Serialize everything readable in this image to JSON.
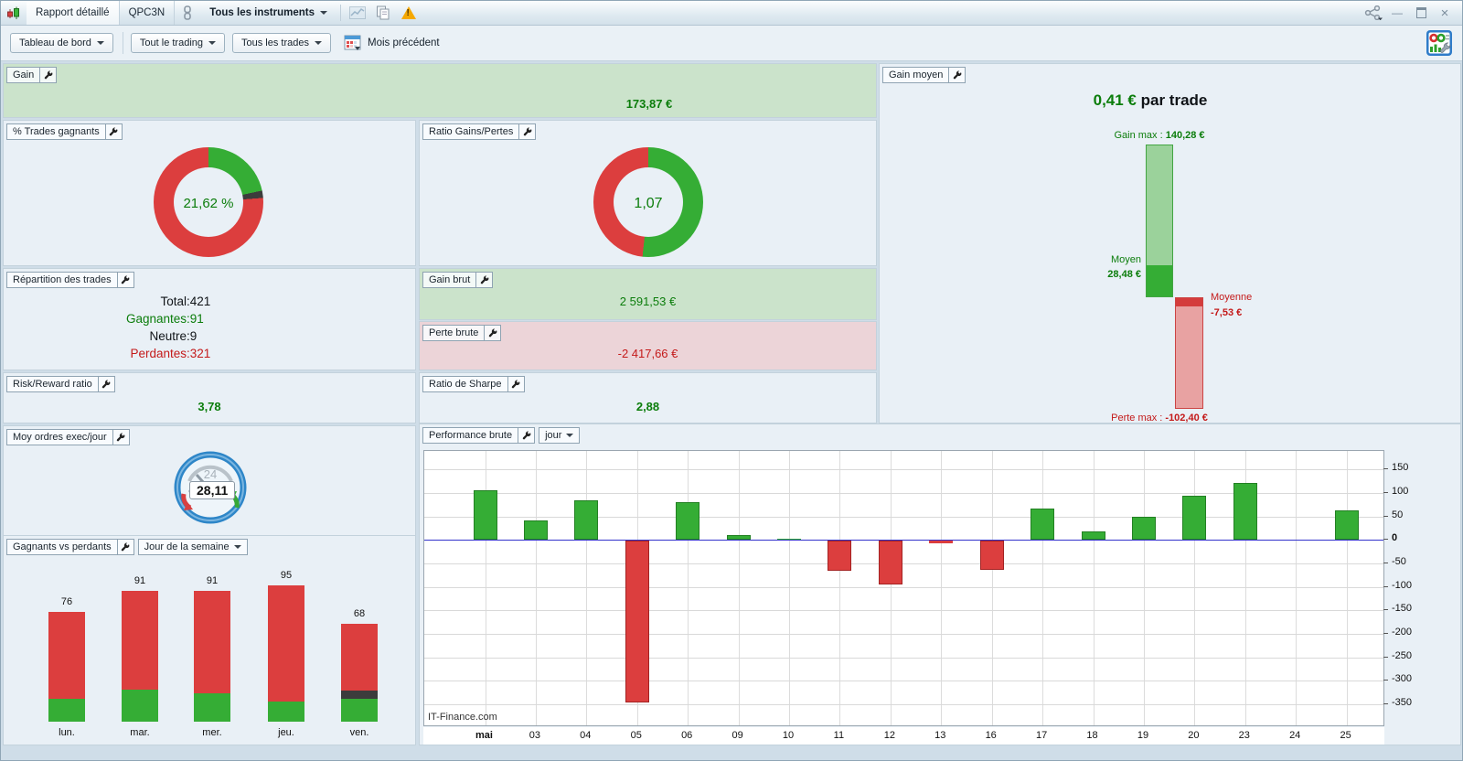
{
  "window": {
    "tabs": [
      "Rapport détaillé",
      "QPC3N"
    ],
    "instrument_selector": "Tous les instruments",
    "icons": [
      "candlestick-icon",
      "link-icon",
      "chart-icon",
      "copy-icon",
      "warning-icon",
      "share-icon",
      "minimize-icon",
      "restore-icon",
      "close-icon"
    ]
  },
  "toolbar": {
    "dashboard_button": "Tableau de bord",
    "trading_scope_button": "Tout le trading",
    "trades_scope_button": "Tous les trades",
    "period_label": "Mois précédent"
  },
  "panels": {
    "gain": {
      "label": "Gain",
      "value": "173,87 €"
    },
    "pct_winning": {
      "label": "% Trades gagnants",
      "value": "21,62 %"
    },
    "ratio_gains_pertes": {
      "label": "Ratio Gains/Pertes",
      "value": "1,07"
    },
    "repartition": {
      "label": "Répartition des trades",
      "rows": [
        {
          "label": "Total",
          "value": "421",
          "color": "tdark"
        },
        {
          "label": "Gagnantes",
          "value": "91",
          "color": "tgreen"
        },
        {
          "label": "Neutre",
          "value": "9",
          "color": "tdark"
        },
        {
          "label": "Perdantes",
          "value": "321",
          "color": "tred"
        }
      ],
      "separator": " : "
    },
    "gain_brut": {
      "label": "Gain brut",
      "value": "2 591,53 €"
    },
    "perte_brute": {
      "label": "Perte brute",
      "value": "-2 417,66 €"
    },
    "risk_reward": {
      "label": "Risk/Reward ratio",
      "value": "3,78"
    },
    "ratio_sharpe": {
      "label": "Ratio de Sharpe",
      "value": "2,88"
    },
    "gain_moyen": {
      "label": "Gain moyen",
      "headline_value": "0,41 €",
      "headline_suffix": " par trade",
      "gain_max_label": "Gain max : ",
      "gain_max_value": "140,28 €",
      "moyen_label": "Moyen",
      "moyen_value": "28,48 €",
      "moyenne_label": "Moyenne",
      "moyenne_value": "-7,53 €",
      "perte_max_label": "Perte max : ",
      "perte_max_value": "-102,40 €"
    },
    "moy_ordres": {
      "label": "Moy ordres exec/jour",
      "value": "28,11",
      "gauge_dial_text": "24"
    },
    "gagnants_perdants": {
      "label": "Gagnants vs perdants",
      "dropdown": "Jour de la semaine"
    },
    "performance": {
      "label": "Performance brute",
      "dropdown": "jour",
      "watermark": "IT-Finance.com"
    }
  },
  "colors": {
    "green_fill": "#35ad35",
    "green_border": "#238023",
    "green_light": "#9bd29b",
    "red_fill": "#dc3e3e",
    "red_border": "#a32222",
    "red_light": "#e8a2a2",
    "neutral_slice": "#3c3c3c",
    "text_green": "#0b7d0b",
    "text_red": "#c41a1a",
    "zero_line_blue": "#3333cc",
    "gain_panel_bg": "#cbe3cb",
    "loss_panel_bg": "#ecd4d8"
  },
  "chart_data": [
    {
      "id": "pct_trades_gagnants",
      "type": "pie",
      "subtype": "donut",
      "title": "% Trades gagnants",
      "center_label": "21,62 %",
      "slices": [
        {
          "label": "gagnants",
          "pct": 21.62,
          "color": "#35ad35"
        },
        {
          "label": "neutres",
          "pct": 2.14,
          "color": "#3c3c3c"
        },
        {
          "label": "perdants",
          "pct": 76.24,
          "color": "#dc3e3e"
        }
      ]
    },
    {
      "id": "ratio_gains_pertes",
      "type": "pie",
      "subtype": "donut",
      "title": "Ratio Gains/Pertes",
      "center_label": "1,07",
      "slices": [
        {
          "label": "gains",
          "pct": 51.7,
          "color": "#35ad35"
        },
        {
          "label": "pertes",
          "pct": 48.3,
          "color": "#dc3e3e"
        }
      ]
    },
    {
      "id": "gain_moyen",
      "type": "bar",
      "title": "Gain moyen (€)",
      "average_per_trade": 0.41,
      "bars": [
        {
          "label": "Gain max",
          "value": 140.28
        },
        {
          "label": "Moyen",
          "value": 28.48
        },
        {
          "label": "Moyenne",
          "value": -7.53
        },
        {
          "label": "Perte max",
          "value": -102.4
        }
      ]
    },
    {
      "id": "gagnants_vs_perdants",
      "type": "bar",
      "subtype": "stacked",
      "title": "Gagnants vs perdants — Jour de la semaine",
      "categories": [
        "lun.",
        "mar.",
        "mer.",
        "jeu.",
        "ven."
      ],
      "totals": [
        76,
        91,
        91,
        95,
        68
      ],
      "series": [
        {
          "name": "gagnants",
          "color": "#35ad35",
          "values": [
            16,
            22,
            20,
            14,
            16
          ]
        },
        {
          "name": "neutres",
          "color": "#3c3c3c",
          "values": [
            0,
            0,
            0,
            0,
            6
          ]
        },
        {
          "name": "perdants",
          "color": "#dc3e3e",
          "values": [
            60,
            69,
            71,
            81,
            46
          ]
        }
      ],
      "note": "segment splits estimated from pixel proportions; totals are labeled on chart"
    },
    {
      "id": "performance_brute",
      "type": "bar",
      "title": "Performance brute — jour",
      "categories": [
        "mai",
        "03",
        "04",
        "05",
        "06",
        "09",
        "10",
        "11",
        "12",
        "13",
        "16",
        "17",
        "18",
        "19",
        "20",
        "23",
        "24",
        "25"
      ],
      "values": [
        106,
        41,
        84,
        -344,
        80,
        10,
        1,
        -65,
        -93,
        -5,
        -62,
        67,
        17,
        48,
        93,
        120,
        0,
        63
      ],
      "yticks": [
        150,
        100,
        50,
        0,
        -50,
        -100,
        -150,
        -200,
        -250,
        -300,
        -350
      ],
      "ylim": [
        -390,
        185
      ],
      "grid": true,
      "y_axis_position": "right",
      "watermark": "IT-Finance.com"
    }
  ]
}
